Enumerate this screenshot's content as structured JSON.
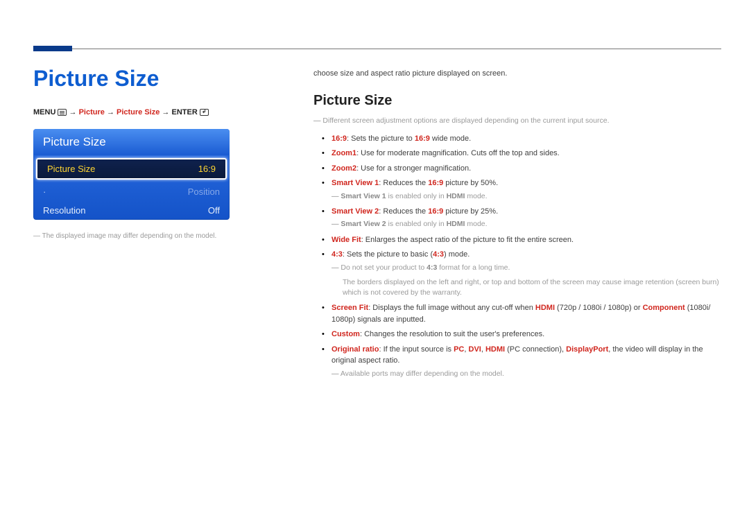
{
  "header": {
    "accent": true
  },
  "left": {
    "title": "Picture Size",
    "breadcrumb": {
      "menu": "MENU",
      "arrow": " → ",
      "picture": "Picture",
      "picture_size": "Picture Size",
      "enter": "ENTER"
    },
    "tv_menu": {
      "title": "Picture Size",
      "rows": [
        {
          "label": "Picture Size",
          "value": "16:9",
          "state": "selected"
        },
        {
          "label": "Position",
          "value": "",
          "state": "dim",
          "dot": "·"
        },
        {
          "label": "Resolution",
          "value": "Off",
          "state": "normal"
        }
      ]
    },
    "note": "The displayed image may differ depending on the model."
  },
  "right": {
    "intro": "choose size and aspect ratio picture displayed on screen.",
    "section_head": "Picture Size",
    "input_note": "Different screen adjustment options are displayed depending on the current input source.",
    "items": {
      "i169_label": "16:9",
      "i169_text": ": Sets the picture to ",
      "i169_tail": " wide mode.",
      "zoom1_label": "Zoom1",
      "zoom1_text": ": Use for moderate magnification. Cuts off the top and sides.",
      "zoom2_label": "Zoom2",
      "zoom2_text": ": Use for a stronger magnification.",
      "sv1_label": "Smart View 1",
      "sv1_text_a": ": Reduces the ",
      "sv1_text_b": " picture by 50%.",
      "sv1_note_a": "Smart View 1",
      "sv1_note_b": " is enabled only in ",
      "sv1_note_c": "HDMI",
      "sv1_note_d": " mode.",
      "sv2_label": "Smart View 2",
      "sv2_text_a": ": Reduces the ",
      "sv2_text_b": " picture by 25%.",
      "sv2_note_a": "Smart View 2",
      "sv2_note_b": " is enabled only in ",
      "sv2_note_c": "HDMI",
      "sv2_note_d": " mode.",
      "wf_label": "Wide Fit",
      "wf_text": ": Enlarges the aspect ratio of the picture to fit the entire screen.",
      "r43_label": "4:3",
      "r43_text_a": ": Sets the picture to basic (",
      "r43_text_b": ") mode.",
      "r43_note1_a": "Do not set your product to ",
      "r43_note1_b": "4:3",
      "r43_note1_c": " format for a long time.",
      "r43_note2": "The borders displayed on the left and right, or top and bottom of the screen may cause image retention (screen burn) which is not covered by the warranty.",
      "sf_label": "Screen Fit",
      "sf_text_a": ": Displays the full image without any cut-off when ",
      "sf_hdmi": "HDMI",
      "sf_text_b": " (720p / 1080i / 1080p) or ",
      "sf_comp": "Component",
      "sf_text_c": " (1080i/ 1080p) signals are inputted.",
      "cu_label": "Custom",
      "cu_text": ": Changes the resolution to suit the user's preferences.",
      "or_label": "Original ratio",
      "or_text_a": ": If the input source is ",
      "or_pc": "PC",
      "or_sep": ", ",
      "or_dvi": "DVI",
      "or_hdmi": "HDMI",
      "or_text_b": " (PC connection), ",
      "or_dp": "DisplayPort",
      "or_text_c": ", the video will display in the original aspect ratio.",
      "or_note": "Available ports may differ depending on the model."
    }
  }
}
